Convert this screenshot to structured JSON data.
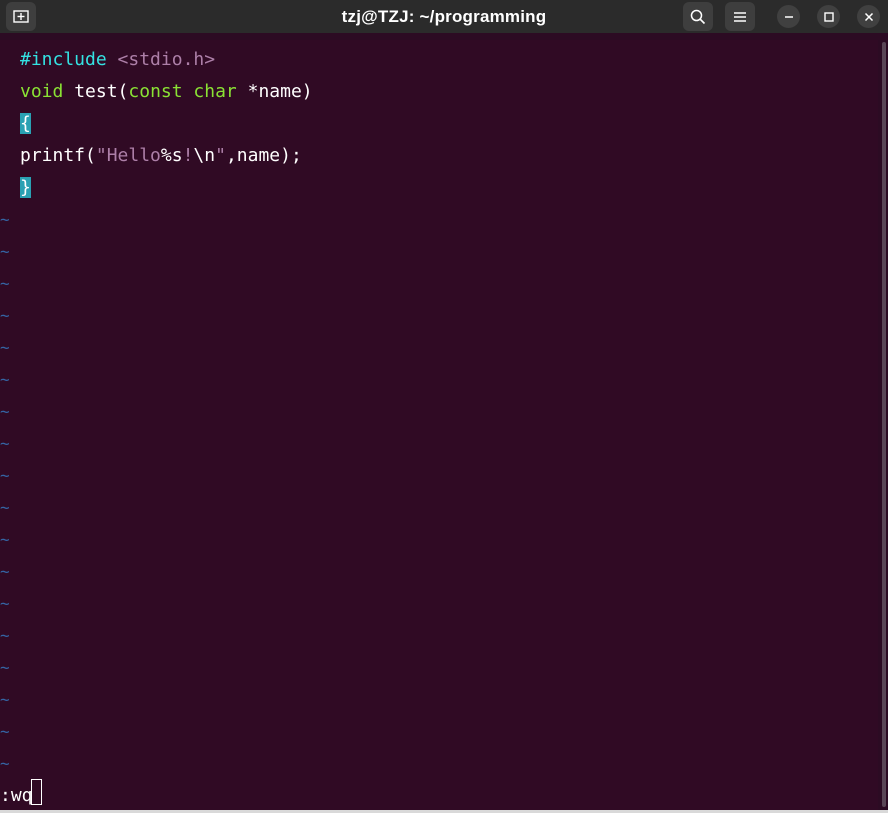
{
  "window": {
    "title": "tzj@TZJ: ~/programming",
    "icons": {
      "new_tab": "new-tab-icon",
      "search": "search-icon",
      "menu": "hamburger-menu-icon",
      "minimize": "minimize-icon",
      "maximize": "maximize-icon",
      "close": "close-icon"
    }
  },
  "editor": {
    "line1": {
      "directive": "#include",
      "header": "<stdio.h>"
    },
    "line2": {
      "kw1": "void",
      "name": "test(",
      "kw2": "const",
      "kw3": "char",
      "rest": "*name)"
    },
    "line3": {
      "brace": "{"
    },
    "line4": {
      "call": "printf(",
      "quote1": "\"",
      "str": "Hello",
      "fmt": "%s",
      "bang": "!",
      "esc": "\\n",
      "quote2": "\"",
      "rest": ",name);"
    },
    "line5": {
      "brace": "}"
    },
    "tilde": "~",
    "command": ":wq"
  },
  "colors": {
    "background": "#300a24",
    "titlebar": "#2b2b2b",
    "preprocessor": "#34e2e2",
    "type_keyword": "#8ae234",
    "string": "#ad7fa8",
    "match_highlight": "#2aa1b3",
    "tilde": "#3465a4"
  }
}
